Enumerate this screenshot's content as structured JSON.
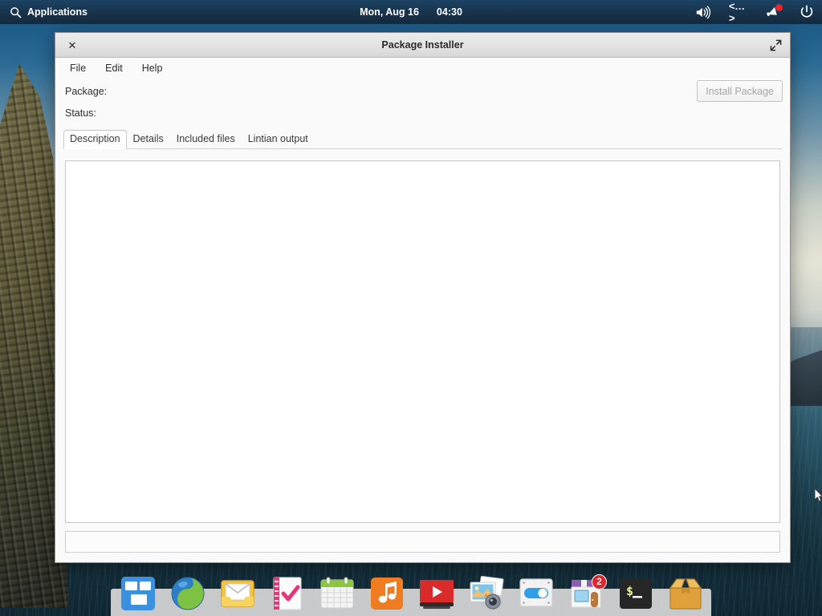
{
  "topbar": {
    "applications_label": "Applications",
    "search_icon": "search-icon",
    "date": "Mon, Aug 16",
    "time": "04:30",
    "tray": [
      {
        "name": "volume-icon",
        "glyph": "volume"
      },
      {
        "name": "network-icon",
        "glyph": "<…>"
      },
      {
        "name": "notifications-icon",
        "glyph": "bell",
        "badge": true
      },
      {
        "name": "power-icon",
        "glyph": "power"
      }
    ]
  },
  "window": {
    "title": "Package Installer",
    "close_label": "✕",
    "maximize_icon": "maximize-icon",
    "menu": [
      {
        "label": "File"
      },
      {
        "label": "Edit"
      },
      {
        "label": "Help"
      }
    ],
    "fields": [
      {
        "label": "Package:",
        "value": ""
      },
      {
        "label": "Status:",
        "value": ""
      }
    ],
    "install_button": "Install Package",
    "install_button_enabled": false,
    "tabs": [
      {
        "label": "Description",
        "active": true
      },
      {
        "label": "Details",
        "active": false
      },
      {
        "label": "Included files",
        "active": false
      },
      {
        "label": "Lintian output",
        "active": false
      }
    ],
    "description_text": "",
    "status_text": ""
  },
  "dock": {
    "items": [
      {
        "name": "dock-item-file-manager",
        "icon": "windows-tiles-icon"
      },
      {
        "name": "dock-item-web-browser",
        "icon": "globe-icon"
      },
      {
        "name": "dock-item-mail",
        "icon": "envelope-icon"
      },
      {
        "name": "dock-item-tasks",
        "icon": "notebook-check-icon"
      },
      {
        "name": "dock-item-calendar",
        "icon": "calendar-icon"
      },
      {
        "name": "dock-item-music",
        "icon": "music-note-icon"
      },
      {
        "name": "dock-item-video",
        "icon": "video-play-icon"
      },
      {
        "name": "dock-item-photos",
        "icon": "photos-camera-icon"
      },
      {
        "name": "dock-item-settings",
        "icon": "toggle-switch-icon"
      },
      {
        "name": "dock-item-software-store",
        "icon": "shop-icon",
        "badge": "2"
      },
      {
        "name": "dock-item-terminal",
        "icon": "terminal-icon"
      },
      {
        "name": "dock-item-archive-manager",
        "icon": "package-box-icon"
      }
    ]
  },
  "colors": {
    "panel_bg": "#16334c",
    "badge_red": "#e0262b",
    "window_bg": "#fafafa",
    "titlebar": "#e6e6e6",
    "accent_blue": "#3b8ede"
  }
}
